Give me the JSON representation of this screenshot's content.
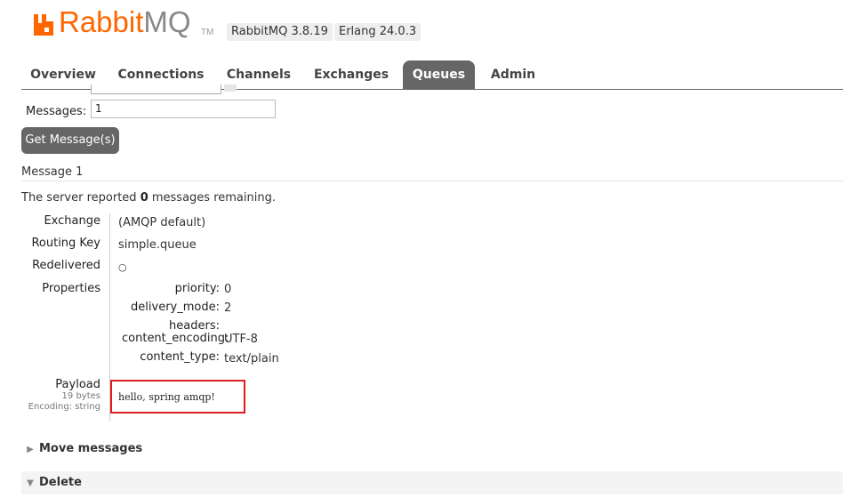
{
  "header": {
    "logo_primary": "Rabbit",
    "logo_secondary": "MQ",
    "logo_tm": "TM",
    "version_badge": "RabbitMQ 3.8.19",
    "erlang_badge": "Erlang 24.0.3"
  },
  "tabs": [
    {
      "label": "Overview"
    },
    {
      "label": "Connections"
    },
    {
      "label": "Channels"
    },
    {
      "label": "Exchanges"
    },
    {
      "label": "Queues",
      "active": true
    },
    {
      "label": "Admin"
    }
  ],
  "form": {
    "messages_label": "Messages:",
    "messages_value": "1",
    "get_button": "Get Message(s)"
  },
  "result": {
    "section_title": "Message 1",
    "report_prefix": "The server reported ",
    "report_count": "0",
    "report_suffix": " messages remaining.",
    "exchange_label": "Exchange",
    "exchange_value": "(AMQP default)",
    "routing_key_label": "Routing Key",
    "routing_key_value": "simple.queue",
    "redelivered_label": "Redelivered",
    "redelivered_value": "○",
    "properties_label": "Properties",
    "properties": [
      {
        "key": "priority:",
        "value": "0"
      },
      {
        "key": "delivery_mode:",
        "value": "2"
      },
      {
        "key": "headers:",
        "value": ""
      },
      {
        "key": "content_encoding:",
        "value": "UTF-8"
      },
      {
        "key": "content_type:",
        "value": "text/plain"
      }
    ],
    "payload_label": "Payload",
    "payload_size": "19 bytes",
    "payload_encoding": "Encoding: string",
    "payload_value": "hello, spring amqp!"
  },
  "sections": {
    "move_messages": "Move messages",
    "delete": "Delete"
  },
  "colors": {
    "brand": "#ff6600",
    "tab_active": "#666666",
    "highlight": "#e21c1c"
  }
}
